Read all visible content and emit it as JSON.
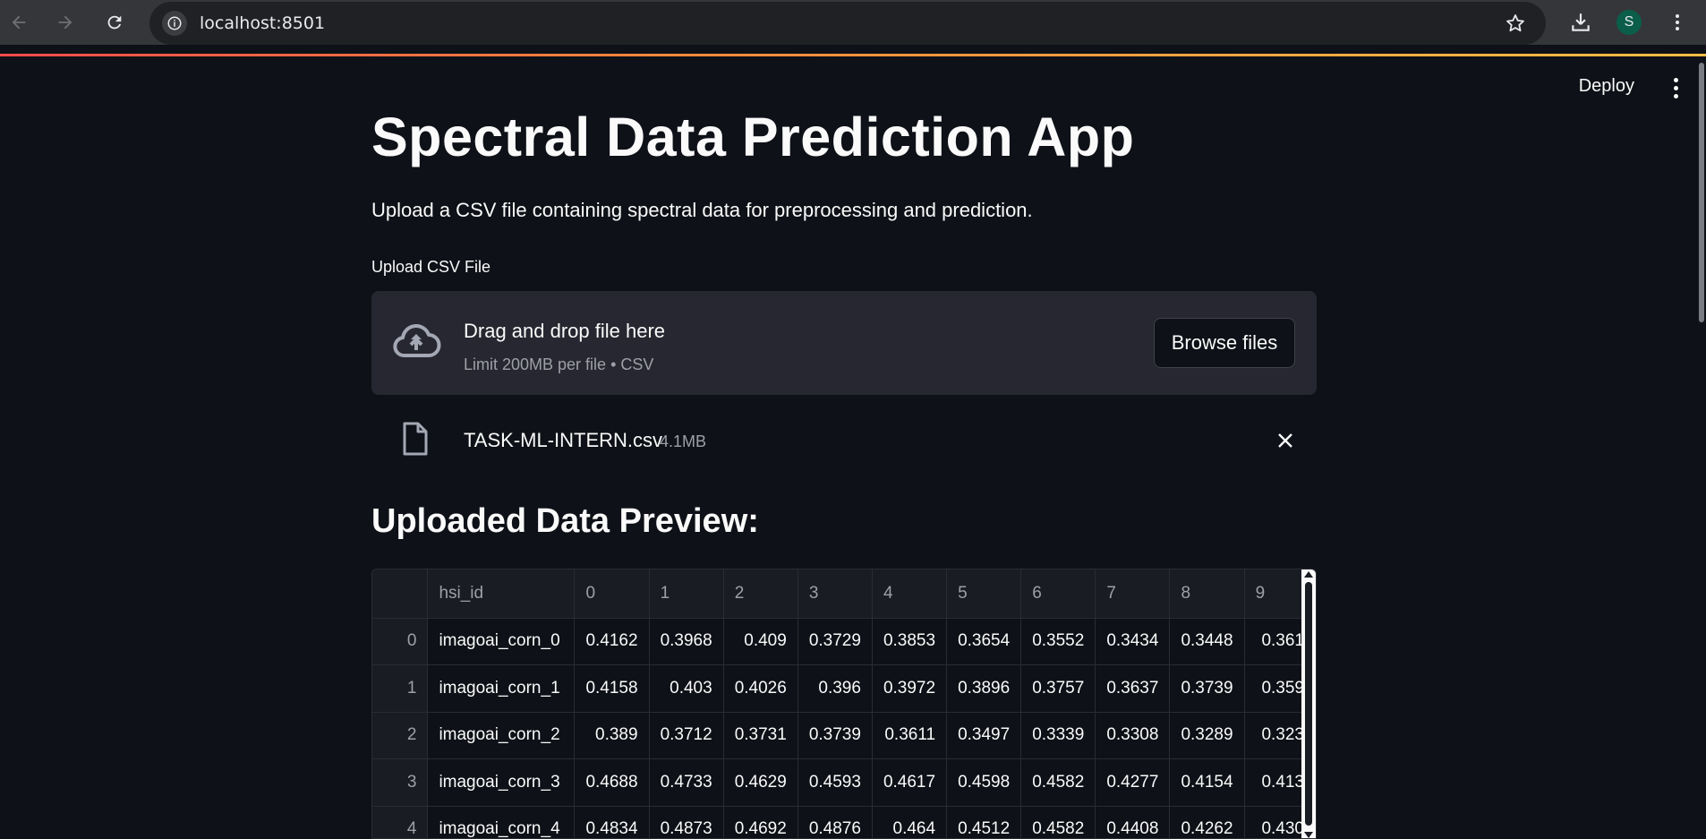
{
  "browser": {
    "url": "localhost:8501",
    "profile_initial": "S",
    "icons": [
      "back-arrow-icon",
      "forward-arrow-icon",
      "reload-icon",
      "site-info-icon",
      "bookmark-star-icon",
      "download-icon",
      "kebab-menu-icon"
    ]
  },
  "header": {
    "deploy_label": "Deploy",
    "menu_icon": "kebab-menu-icon"
  },
  "main": {
    "title": "Spectral Data Prediction App",
    "subtitle": "Upload a CSV file containing spectral data for preprocessing and prediction."
  },
  "uploader": {
    "label": "Upload CSV File",
    "dropzone_title": "Drag and drop file here",
    "dropzone_limit": "Limit 200MB per file • CSV",
    "browse_label": "Browse files",
    "icon": "cloud-upload-icon"
  },
  "uploaded_file": {
    "name": "TASK-ML-INTERN.csv",
    "size": "4.1MB",
    "icon": "file-icon",
    "remove_icon": "close-icon"
  },
  "preview": {
    "heading": "Uploaded Data Preview:",
    "columns": [
      "",
      "hsi_id",
      "0",
      "1",
      "2",
      "3",
      "4",
      "5",
      "6",
      "7",
      "8",
      "9"
    ],
    "rows": [
      [
        "0",
        "imagoai_corn_0",
        "0.4162",
        "0.3968",
        "0.409",
        "0.3729",
        "0.3853",
        "0.3654",
        "0.3552",
        "0.3434",
        "0.3448",
        "0.361"
      ],
      [
        "1",
        "imagoai_corn_1",
        "0.4158",
        "0.403",
        "0.4026",
        "0.396",
        "0.3972",
        "0.3896",
        "0.3757",
        "0.3637",
        "0.3739",
        "0.359"
      ],
      [
        "2",
        "imagoai_corn_2",
        "0.389",
        "0.3712",
        "0.3731",
        "0.3739",
        "0.3611",
        "0.3497",
        "0.3339",
        "0.3308",
        "0.3289",
        "0.323"
      ],
      [
        "3",
        "imagoai_corn_3",
        "0.4688",
        "0.4733",
        "0.4629",
        "0.4593",
        "0.4617",
        "0.4598",
        "0.4582",
        "0.4277",
        "0.4154",
        "0.413"
      ],
      [
        "4",
        "imagoai_corn_4",
        "0.4834",
        "0.4873",
        "0.4692",
        "0.4876",
        "0.464",
        "0.4512",
        "0.4582",
        "0.4408",
        "0.4262",
        "0.430"
      ]
    ]
  },
  "colors": {
    "background": "#0e1117",
    "surface": "#262730",
    "text": "#fafafa",
    "muted": "#9ea0a8",
    "accent": "#ff4b4b"
  }
}
